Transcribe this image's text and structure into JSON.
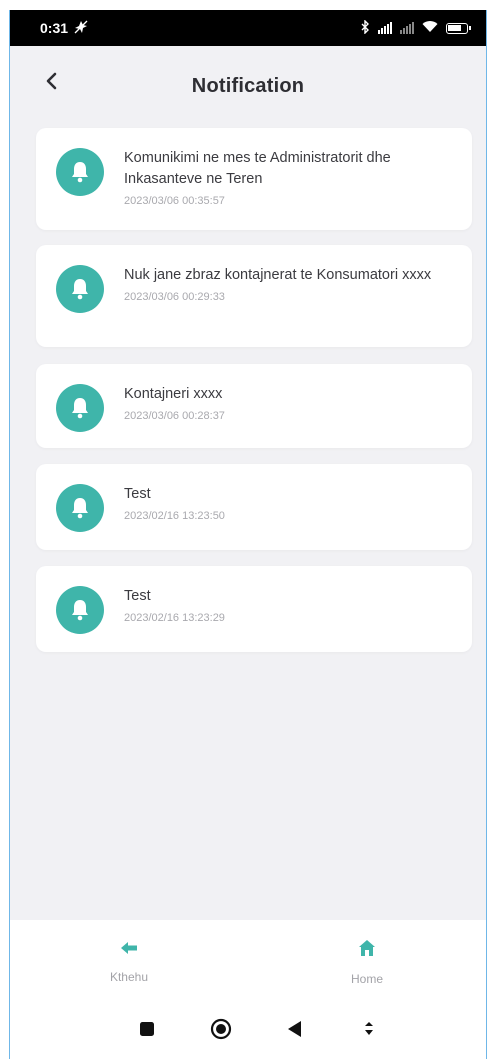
{
  "status_bar": {
    "time": "0:31",
    "battery": "58"
  },
  "header": {
    "title": "Notification"
  },
  "notifications": [
    {
      "title": "Komunikimi ne mes te Administratorit dhe Inkasanteve ne Teren",
      "time": "2023/03/06 00:35:57"
    },
    {
      "title": "Nuk jane zbraz kontajnerat te Konsumatori xxxx",
      "time": "2023/03/06 00:29:33"
    },
    {
      "title": "Kontajneri xxxx",
      "time": "2023/03/06 00:28:37"
    },
    {
      "title": "Test",
      "time": "2023/02/16 13:23:50"
    },
    {
      "title": "Test",
      "time": "2023/02/16 13:23:29"
    }
  ],
  "bottom_nav": {
    "back_label": "Kthehu",
    "home_label": "Home"
  },
  "colors": {
    "accent": "#3fb5aa",
    "background": "#f1f1f4",
    "text": "#3b3b40",
    "muted": "#a9a9ae"
  },
  "icons": {
    "notification": "bell-icon",
    "back": "chevron-left-icon",
    "nav_back": "arrow-left-icon",
    "nav_home": "home-icon"
  }
}
